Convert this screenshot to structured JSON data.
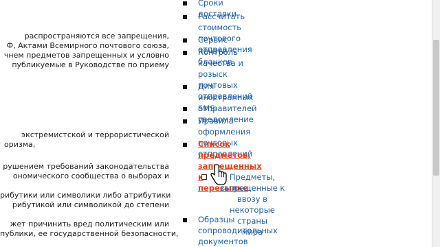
{
  "article": {
    "lines": [
      "распространяются все запрещения,",
      "Ф, Актами Всемирного почтового союза,",
      "чнем предметов запрещенных и условно",
      "публикуемые в Руководстве по приему",
      "экстремистской и террористической",
      "оризма,",
      "рушением требований законодательства",
      "ономического сообщества о выборах и",
      "рибутики или символики либо атрибутики",
      "рибутикой или символикой до степени",
      "жет причинить вред политическим или",
      "публики, ее государственной безопасности,"
    ]
  },
  "nav": {
    "items": [
      {
        "label": "Сроки доставки"
      },
      {
        "label": "Рассчитать стоимость\nпочтового отправления"
      },
      {
        "label": "Сервис печати бланков"
      },
      {
        "label": "Контроль качества и\nрозыск почтовых\nотправлений"
      },
      {
        "label": "Для иностранных\nотправителей"
      },
      {
        "label": "SMS-уведомление"
      },
      {
        "label": "Правила оформления\nпочтовых отправлений"
      },
      {
        "label": "Список предметов,\nзапрещенных к\nпересылке"
      },
      {
        "label": "Образцы\nсопроводительных\nдокументов"
      }
    ],
    "sub_item": {
      "label": "Предметы,\nзапрещенные к ввозу в\nнекоторые страны\nмира"
    }
  },
  "colors": {
    "link": "#1f5fa8",
    "active_link": "#e8411b"
  }
}
